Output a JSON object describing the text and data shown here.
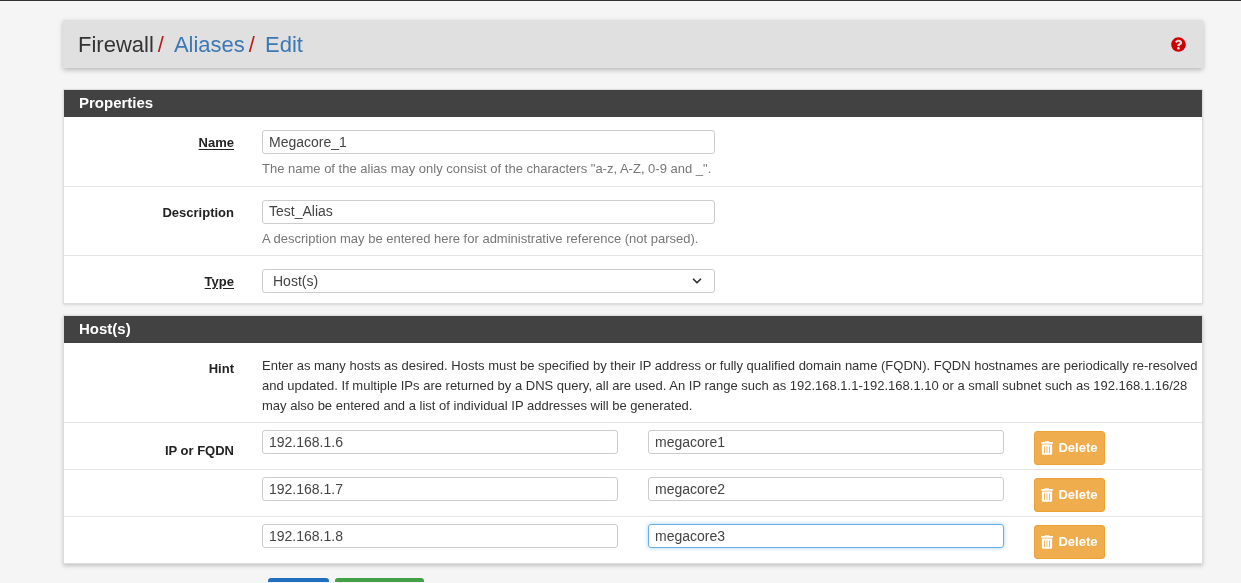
{
  "breadcrumb": [
    {
      "label": "Firewall",
      "link": false,
      "separator": "/"
    },
    {
      "label": "Aliases",
      "link": true,
      "separator": "/"
    },
    {
      "label": "Edit",
      "link": true
    }
  ],
  "properties": {
    "title": "Properties",
    "rows": [
      {
        "kind": "text",
        "label": "Name",
        "underlined": true,
        "value": "Megacore_1",
        "help": "The name of the alias may only consist of the characters \"a-z, A-Z, 0-9 and _\"."
      },
      {
        "kind": "text",
        "label": "Description",
        "underlined": false,
        "value": "Test_Alias",
        "help": "A description may be entered here for administrative reference (not parsed)."
      },
      {
        "kind": "select",
        "label": "Type",
        "underlined": true,
        "value": "Host(s)"
      }
    ]
  },
  "hosts": {
    "title": "Host(s)",
    "hint_label": "Hint",
    "hint": "Enter as many hosts as desired. Hosts must be specified by their IP address or fully qualified domain name (FQDN). FQDN hostnames are periodically re-resolved and updated. If multiple IPs are returned by a DNS query, all are used. An IP range such as 192.168.1.1-192.168.1.10 or a small subnet such as 192.168.1.16/28 may also be entered and a list of individual IP addresses will be generated.",
    "field_label": "IP or FQDN",
    "entries": [
      {
        "address": "192.168.1.6",
        "description": "megacore1",
        "focused": false,
        "button": "Delete"
      },
      {
        "address": "192.168.1.7",
        "description": "megacore2",
        "focused": false,
        "button": "Delete"
      },
      {
        "address": "192.168.1.8",
        "description": "megacore3",
        "focused": true,
        "button": "Delete"
      }
    ]
  },
  "footer_buttons": [
    {
      "kind": "primary"
    },
    {
      "kind": "success"
    }
  ]
}
